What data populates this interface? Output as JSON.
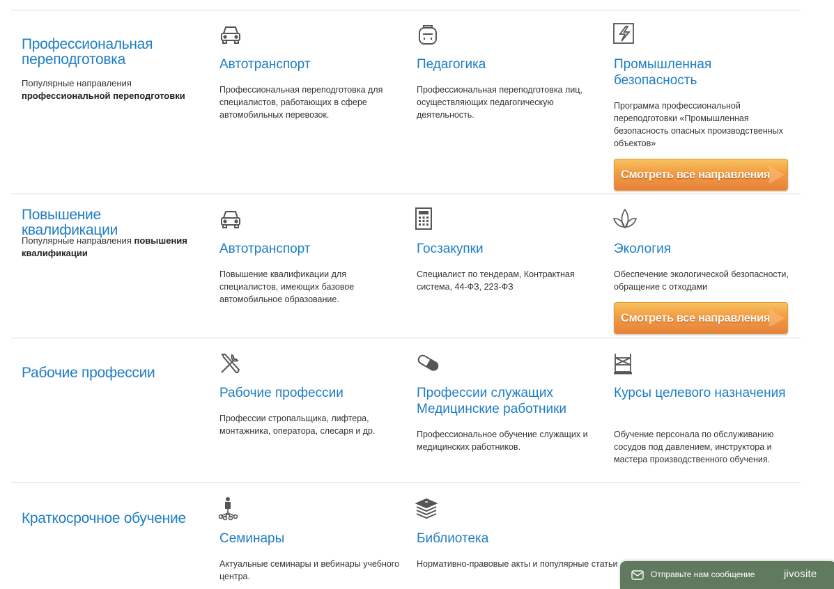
{
  "sections": [
    {
      "title": "Профессиональная переподготовка",
      "desc_prefix": "Популярные направления",
      "desc_bold": "профессиональной переподготовки",
      "cards": [
        {
          "icon": "car-icon",
          "title": "Автотранспорт",
          "desc": "Профессиональная переподготовка для специалистов, работающих в сфере автомобильных перевозок."
        },
        {
          "icon": "backpack-icon",
          "title": "Педагогика",
          "desc": "Профессиональная переподготовка лиц, осуществляющих педагогическую деятельность."
        },
        {
          "icon": "lightning-box-icon",
          "title": "Промышленная безопасность",
          "desc": "Программа профессиональной переподготовки «Промышленная безопасность опасных производственных объектов»"
        }
      ],
      "cta": "Смотреть все направления"
    },
    {
      "title": "Повышение квалификации",
      "desc_prefix": "Популярные направления",
      "desc_bold": "повышения квалификации",
      "cards": [
        {
          "icon": "car-icon",
          "title": "Автотранспорт",
          "desc": "Повышение квалификации для специалистов, имеющих базовое автомобильное образование."
        },
        {
          "icon": "calculator-icon",
          "title": "Госзакупки",
          "desc": "Специалист по тендерам, Контрактная система, 44-ФЗ, 223-ФЗ"
        },
        {
          "icon": "leaf-icon",
          "title": "Экология",
          "desc": "Обеспечение экологической безопасности, обращение с отходами"
        }
      ],
      "cta": "Смотреть все направления"
    },
    {
      "title": "Рабочие профессии",
      "cards": [
        {
          "icon": "tools-icon",
          "title": "Рабочие профессии",
          "desc": "Профессии стропальщика, лифтера, монтажника, оператора, слесаря и др."
        },
        {
          "icon": "pill-icon",
          "title": "Профессии служащих Медицинские работники",
          "desc": "Профессиональное обучение служащих и медицинских работников."
        },
        {
          "icon": "scaffold-icon",
          "title": "Курсы целевого назначения",
          "desc": "Обучение персонала по обслуживанию сосудов под давлением, инструктора и мастера производственного обучения."
        }
      ]
    },
    {
      "title": "Краткосрочное обучение",
      "cards": [
        {
          "icon": "network-person-icon",
          "title": "Семинары",
          "desc": "Актуальные семинары и вебинары учебного центра."
        },
        {
          "icon": "books-icon",
          "title": "Библиотека",
          "desc": "Нормативно-правовые акты и популярные статьи"
        }
      ]
    }
  ],
  "chat_widget": {
    "icon": "envelope-icon",
    "message": "Отправьте нам сообщение",
    "brand": "jivosite"
  }
}
